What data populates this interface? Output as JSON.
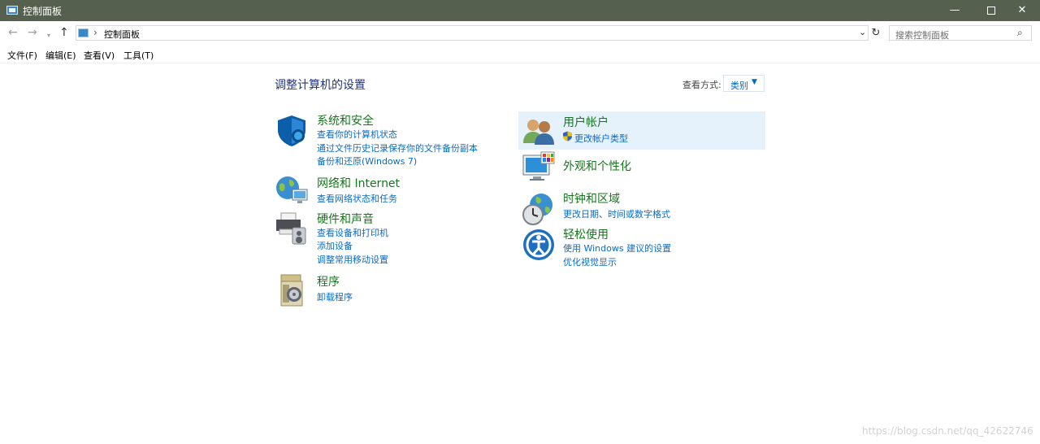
{
  "window": {
    "title": "控制面板",
    "minimize": "—",
    "close": "✕"
  },
  "nav": {
    "back": "←",
    "forward": "→",
    "recent": "▾",
    "up": "↑",
    "address_sep": "›",
    "address_path": "控制面板",
    "address_dropdown": "⌄",
    "refresh": "↻",
    "search_placeholder": "搜索控制面板",
    "search_icon": "⌕"
  },
  "menu": [
    "文件(F)",
    "编辑(E)",
    "查看(V)",
    "工具(T)"
  ],
  "main": {
    "heading": "调整计算机的设置",
    "view_by_label": "查看方式:",
    "view_by_value": "类别",
    "view_by_caret": "▼"
  },
  "categories_left": [
    {
      "title": "系统和安全",
      "icon": "shield-icon",
      "links": [
        "查看你的计算机状态",
        "通过文件历史记录保存你的文件备份副本",
        "备份和还原(Windows 7)"
      ]
    },
    {
      "title": "网络和 Internet",
      "icon": "network-globe-icon",
      "links": [
        "查看网络状态和任务"
      ]
    },
    {
      "title": "硬件和声音",
      "icon": "printer-speaker-icon",
      "links": [
        "查看设备和打印机",
        "添加设备",
        "调整常用移动设置"
      ]
    },
    {
      "title": "程序",
      "icon": "programs-icon",
      "links": [
        "卸载程序"
      ]
    }
  ],
  "categories_right": [
    {
      "title": "用户帐户",
      "icon": "users-icon",
      "links": [
        "更改帐户类型"
      ]
    },
    {
      "title": "外观和个性化",
      "icon": "monitor-palette-icon",
      "links": []
    },
    {
      "title": "时钟和区域",
      "icon": "clock-globe-icon",
      "links": [
        "更改日期、时间或数字格式"
      ]
    },
    {
      "title": "轻松使用",
      "icon": "ease-of-access-icon",
      "links": [
        "使用 Windows 建议的设置",
        "优化视觉显示"
      ]
    }
  ],
  "watermark": "https://blog.csdn.net/qq_42622746",
  "colors": {
    "titlebar": "#55604f",
    "category_title": "#16761c",
    "link": "#0a6bc9",
    "heading": "#1e3287",
    "highlight": "#e5f1fb"
  }
}
